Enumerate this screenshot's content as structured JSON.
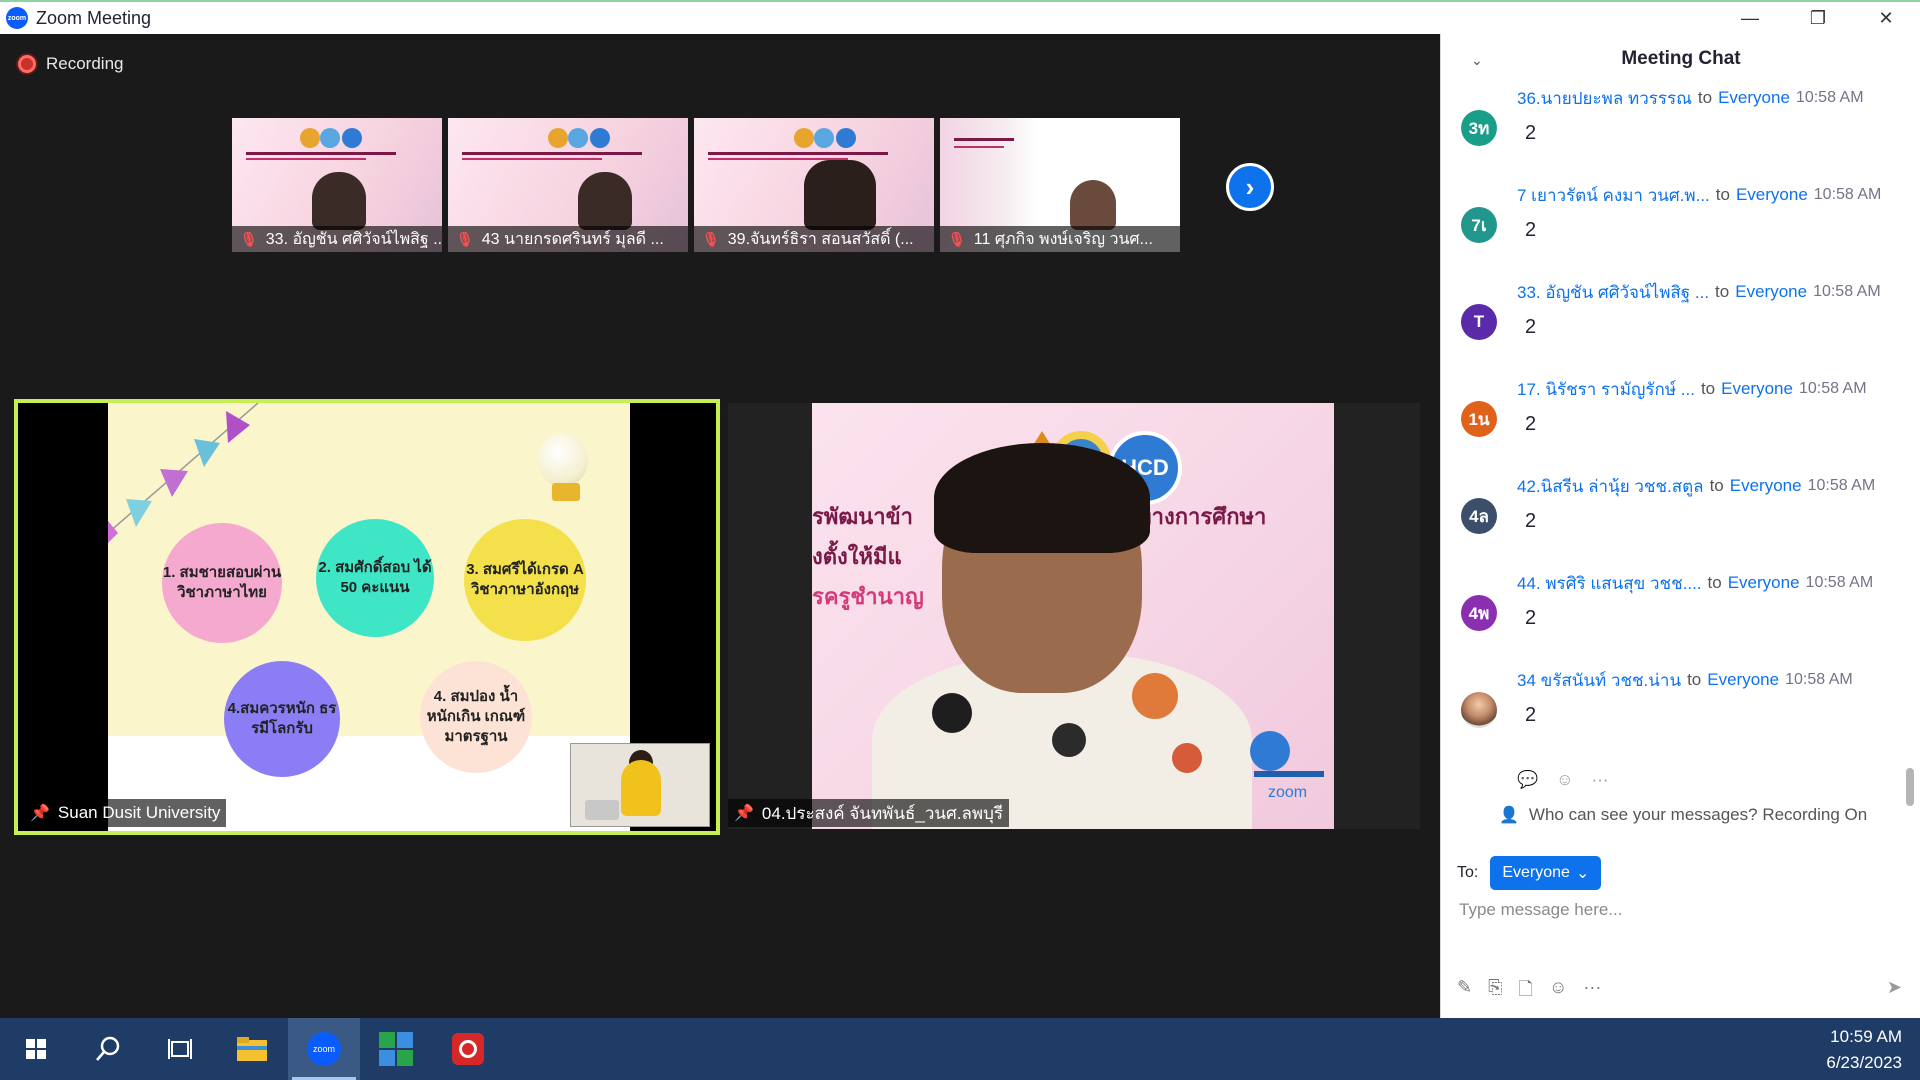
{
  "window": {
    "title": "Zoom Meeting",
    "minimize": "—",
    "restore": "❐",
    "close": "✕"
  },
  "meeting": {
    "recording_label": "Recording",
    "strip": [
      {
        "name": "33. อัญชัน ศศิวัจน์ไพสิฐ ..."
      },
      {
        "name": "43 นายกรดศรินทร์ มุลดี ..."
      },
      {
        "name": "39.จันทร์ธิรา สอนสวัสดิ์ (..."
      },
      {
        "name": "11 ศุภกิจ พงษ์เจริญ วนศ..."
      }
    ],
    "left_video": {
      "name": "Suan Dusit University",
      "slide_items": [
        "1. สมชายสอบผ่าน วิชาภาษาไทย",
        "2. สมศักดิ์สอบ ได้ 50 คะแนน",
        "3. สมศรีได้เกรด A วิชาภาษาอังกฤษ",
        "4.สมควรหนัก ธรรมีโลกรับ",
        "4. สมปอง น้ำหนักเกิน เกณฑ์มาตรฐาน"
      ]
    },
    "right_video": {
      "name": "04.ประสงค์ จันทพันธ์_วนศ.ลพบุรี",
      "banner_line1": "รพัฒนาข้า",
      "banner_line2": "กรทางการศึกษา",
      "banner_line3": "งตั้งให้มีแ",
      "banner_line4": "รครูชำนาญ",
      "logo_text": "HCD",
      "corner_text": "zoom"
    }
  },
  "chat": {
    "title": "Meeting Chat",
    "messages": [
      {
        "sender": "36.นายปยะพล ทวรรรณ",
        "to": "to",
        "recipient": "Everyone",
        "time": "10:58 AM",
        "text": "2",
        "avatar": "3ท",
        "color": "#1a9e8a"
      },
      {
        "sender": "7 เยาวรัตน์ คงมา วนศ.พ...",
        "to": "to",
        "recipient": "Everyone",
        "time": "10:58 AM",
        "text": "2",
        "avatar": "7เ",
        "color": "#20968c"
      },
      {
        "sender": "33. อัญชัน ศศิวัจน์ไพสิฐ ...",
        "to": "to",
        "recipient": "Everyone",
        "time": "10:58 AM",
        "text": "2",
        "avatar": "T",
        "color": "#5b2aa8"
      },
      {
        "sender": "17. นิรัชรา  รามัญรักษ์  ...",
        "to": "to",
        "recipient": "Everyone",
        "time": "10:58 AM",
        "text": "2",
        "avatar": "1น",
        "color": "#e0621a"
      },
      {
        "sender": "42.นิสรีน ล่านุ้ย  วชช.สตูล",
        "to": "to",
        "recipient": "Everyone",
        "time": "10:58 AM",
        "text": "2",
        "avatar": "4ล",
        "color": "#3b4f6b"
      },
      {
        "sender": "44. พรศิริ แสนสุข วชช....",
        "to": "to",
        "recipient": "Everyone",
        "time": "10:58 AM",
        "text": "2",
        "avatar": "4พ",
        "color": "#8a2fb0"
      },
      {
        "sender": "34 ขรัสนันท์ วชช.น่าน",
        "to": "to",
        "recipient": "Everyone",
        "time": "10:58 AM",
        "text": "2",
        "avatar": "",
        "color": "#cccccc"
      }
    ],
    "privacy_text": "Who can see your messages? Recording On",
    "to_label": "To:",
    "to_value": "Everyone",
    "input_placeholder": "Type message here..."
  },
  "taskbar": {
    "time": "10:59 AM",
    "date": "6/23/2023",
    "zoom_label": "zoom"
  }
}
